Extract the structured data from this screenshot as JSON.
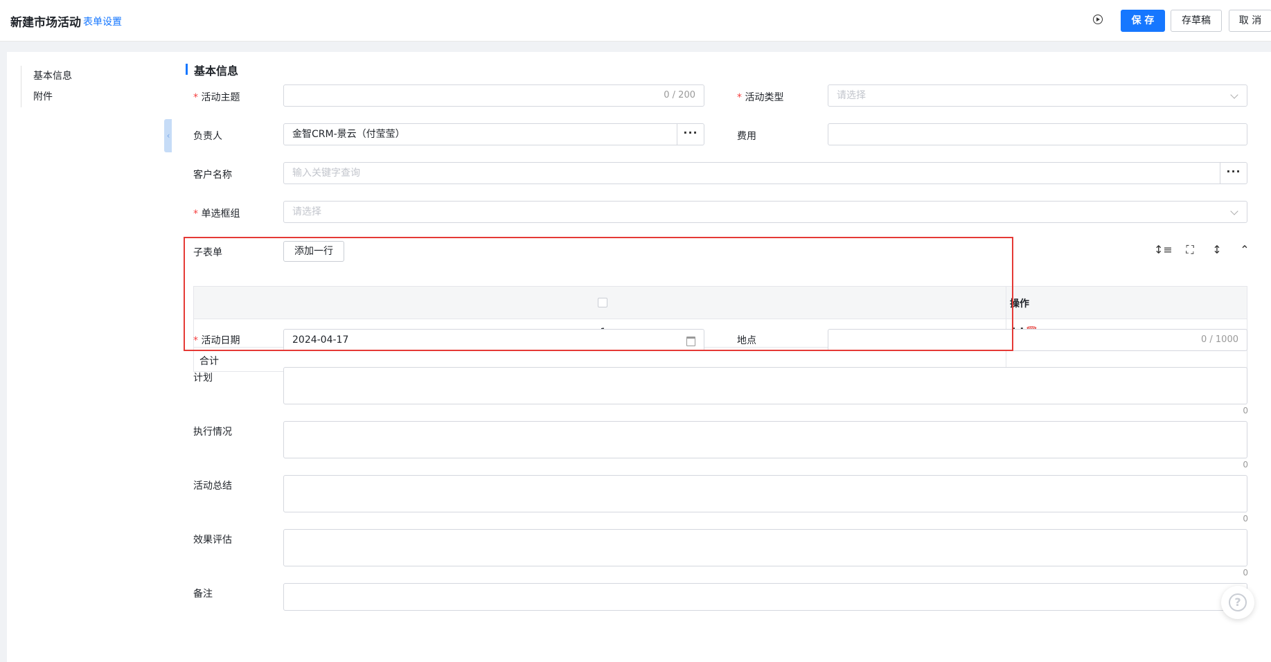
{
  "header": {
    "title": "新建市场活动",
    "form_settings": "表单设置",
    "save": "保 存",
    "draft": "存草稿",
    "cancel": "取 消"
  },
  "sidebar": {
    "items": [
      {
        "label": "基本信息"
      },
      {
        "label": "附件"
      }
    ]
  },
  "section": {
    "title": "基本信息"
  },
  "fields": {
    "subject": {
      "label": "活动主题",
      "value": "",
      "counter": "0 / 200",
      "required": true
    },
    "type": {
      "label": "活动类型",
      "placeholder": "请选择",
      "required": true
    },
    "owner": {
      "label": "负责人",
      "value": "金智CRM-景云（付莹莹）"
    },
    "cost": {
      "label": "费用",
      "value": ""
    },
    "customer": {
      "label": "客户名称",
      "placeholder": "输入关键字查询"
    },
    "radio_group": {
      "label": "单选框组",
      "placeholder": "请选择",
      "required": true
    },
    "date": {
      "label": "活动日期",
      "value": "2024-04-17",
      "required": true
    },
    "location": {
      "label": "地点",
      "value": "",
      "counter": "0 / 1000"
    },
    "plan": {
      "label": "计划",
      "counter": "0"
    },
    "execution": {
      "label": "执行情况",
      "counter": "0"
    },
    "summary": {
      "label": "活动总结",
      "counter": "0"
    },
    "evaluation": {
      "label": "效果评估",
      "counter": "0"
    },
    "remark": {
      "label": "备注"
    }
  },
  "subform": {
    "label": "子表单",
    "add_row": "添加一行",
    "op_header": "操作",
    "rows": [
      {
        "index": "1"
      }
    ],
    "total_label": "合计"
  },
  "icons": {
    "run": "play-circle-icon",
    "toolbar": [
      "row-height-icon",
      "fullscreen-icon",
      "expand-vertical-icon",
      "collapse-up-icon"
    ],
    "help": "help-icon"
  },
  "colors": {
    "primary": "#1677ff",
    "required": "#f53f3f",
    "highlight": "#e53935"
  }
}
